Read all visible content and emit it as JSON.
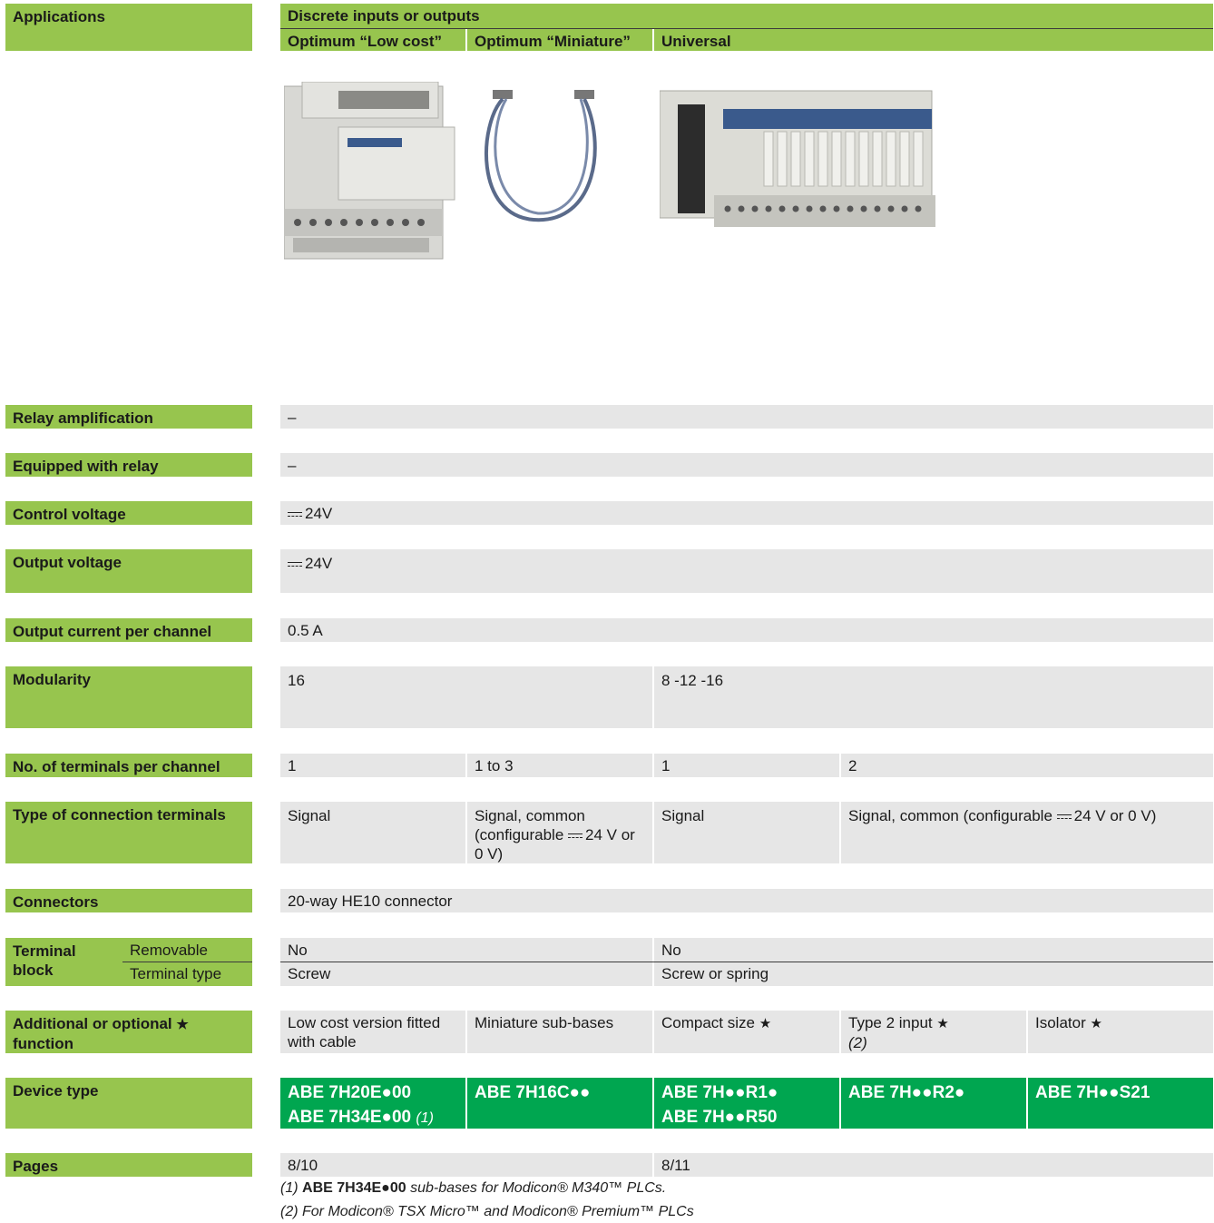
{
  "header": {
    "applications": "Applications",
    "discrete": "Discrete inputs or outputs",
    "col_low_cost": "Optimum “Low cost”",
    "col_miniature": "Optimum “Miniature”",
    "col_universal": "Universal"
  },
  "rows": {
    "relay_amplification": {
      "label": "Relay amplification",
      "value": "–"
    },
    "equipped_with_relay": {
      "label": "Equipped with relay",
      "value": "–"
    },
    "control_voltage": {
      "label": "Control voltage",
      "value": "24V"
    },
    "output_voltage": {
      "label": "Output voltage",
      "value": "24V"
    },
    "output_current": {
      "label": "Output current per channel",
      "value": "0.5 A"
    },
    "modularity": {
      "label": "Modularity",
      "values": [
        "16",
        "8 -12 -16"
      ]
    },
    "terminals_per_channel": {
      "label": "No. of terminals per channel",
      "values": [
        "1",
        "1 to 3",
        "1",
        "2"
      ]
    },
    "connection_terminals": {
      "label": "Type of connection terminals",
      "v1": "Signal",
      "v2a": "Signal, common (configurable",
      "v2b": "24 V or 0 V)",
      "v3": "Signal",
      "v4a": "Signal, common (configurable",
      "v4b": "24 V or 0 V)"
    },
    "connectors": {
      "label": "Connectors",
      "value": "20-way HE10 connector"
    },
    "terminal_block": {
      "label": "Terminal block",
      "removable_label": "Removable",
      "terminal_type_label": "Terminal type",
      "removable": [
        "No",
        "No"
      ],
      "terminal_type": [
        "Screw",
        "Screw or spring"
      ]
    },
    "additional_function": {
      "label": "Additional or optional",
      "label2": "function",
      "values": [
        "Low cost version fitted with cable",
        "Miniature sub-bases",
        "Compact size",
        "Type 2 input",
        "Isolator"
      ],
      "note_ref": "(2)"
    },
    "device_type": {
      "label": "Device type",
      "d1a": "ABE 7H20E●00",
      "d1b": "ABE 7H34E●00",
      "d1b_ref": "(1)",
      "d2": "ABE 7H16C●●",
      "d3a": "ABE 7H●●R1●",
      "d3b": "ABE 7H●●R50",
      "d4": "ABE 7H●●R2●",
      "d5": "ABE 7H●●S21"
    },
    "pages": {
      "label": "Pages",
      "values": [
        "8/10",
        "8/11"
      ]
    }
  },
  "star": "★",
  "footnotes": {
    "f1_ref": "(1)",
    "f1_bold": "ABE 7H34E●00",
    "f1_text": "sub-bases for Modicon® M340™ PLCs.",
    "f2": "(2) For Modicon® TSX Micro™ and Modicon® Premium™ PLCs"
  },
  "colors": {
    "label_green": "#97c54e",
    "device_green": "#00a650",
    "cell_grey": "#e6e6e6"
  }
}
